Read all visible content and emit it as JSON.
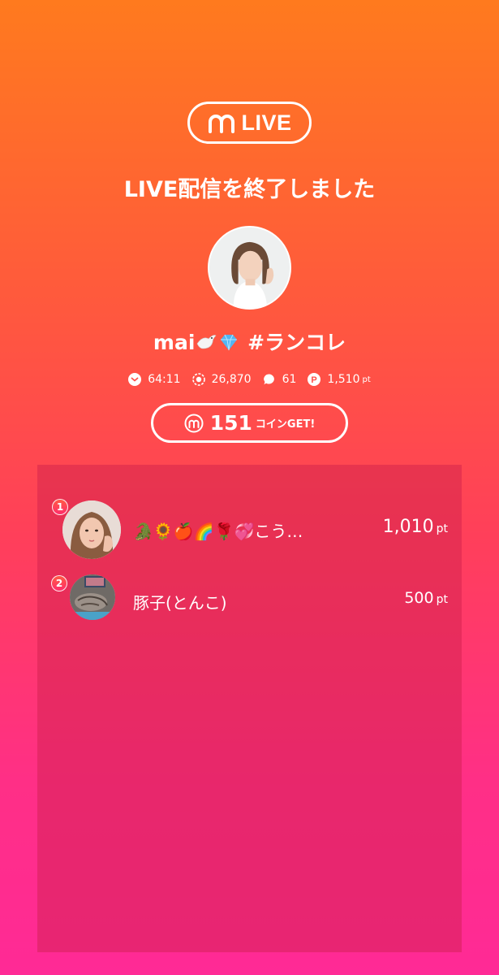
{
  "logo": {
    "text": "LIVE"
  },
  "header": {
    "title": "LIVE配信を終了しました"
  },
  "streamer": {
    "name_prefix": "mai",
    "name_suffix": "#ランコレ"
  },
  "stats": {
    "duration": "64:11",
    "viewers": "26,870",
    "comments": "61",
    "points": "1,510",
    "points_unit": "pt"
  },
  "coins": {
    "count": "151",
    "label": "コインGET!"
  },
  "ranking": [
    {
      "rank": "1",
      "name": "🐊🌻🍎🌈🌹💞こう…",
      "points": "1,010",
      "unit": "pt"
    },
    {
      "rank": "2",
      "name": "豚子(とんこ)",
      "points": "500",
      "unit": "pt"
    }
  ],
  "colors": {
    "gradient_top": "#ff7a1e",
    "gradient_bottom": "#ff2a96",
    "panel": "#cd1e4b",
    "text": "#ffffff"
  }
}
